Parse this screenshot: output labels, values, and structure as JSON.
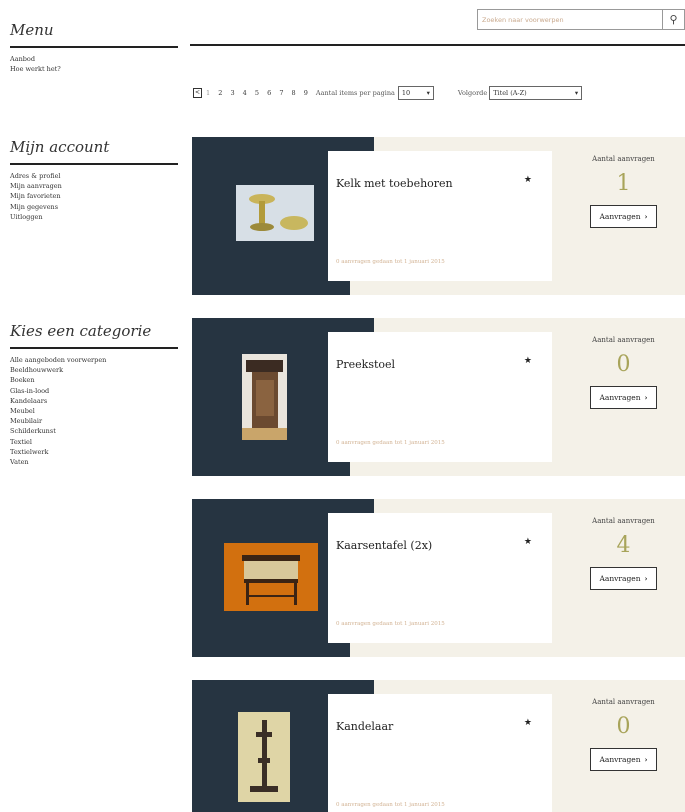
{
  "sidebar": {
    "menu": {
      "heading": "Menu",
      "items": [
        "Aanbod",
        "Hoe werkt het?"
      ]
    },
    "account": {
      "heading": "Mijn account",
      "items": [
        "Adres & profiel",
        "Mijn aanvragen",
        "Mijn favorieten",
        "Mijn gegevens",
        "Uitloggen"
      ]
    },
    "categories": {
      "heading": "Kies een categorie",
      "items": [
        "Alle aangeboden voorwerpen",
        "Beeldhouwwerk",
        "Boeken",
        "Glas-in-lood",
        "Kandelaars",
        "Meubel",
        "Meubilair",
        "Schilderkunst",
        "Textiel",
        "Textielwerk",
        "Vaten"
      ]
    }
  },
  "search": {
    "placeholder": "Zoeken naar voorwerpen",
    "icon": "search-icon"
  },
  "pager": {
    "first_label": "<",
    "pages": [
      "1",
      "2",
      "3",
      "4",
      "5",
      "6",
      "7",
      "8",
      "9"
    ],
    "per_page_label": "Aantal items per pagina",
    "per_page_value": "10",
    "sort_label": "Volgorde",
    "sort_value": "Titel (A-Z)"
  },
  "items": [
    {
      "title": "Kelk met toebehoren",
      "subtitle": "0 aanvragen gedaan tot 1 januari 2015",
      "req_label": "Aantal aanvragen",
      "count": "1",
      "button": "Aanvragen"
    },
    {
      "title": "Preekstoel",
      "subtitle": "0 aanvragen gedaan tot 1 januari 2015",
      "req_label": "Aantal aanvragen",
      "count": "0",
      "button": "Aanvragen"
    },
    {
      "title": "Kaarsentafel (2x)",
      "subtitle": "0 aanvragen gedaan tot 1 januari 2015",
      "req_label": "Aantal aanvragen",
      "count": "4",
      "button": "Aanvragen"
    },
    {
      "title": "Kandelaar",
      "subtitle": "0 aanvragen gedaan tot 1 januari 2015",
      "req_label": "Aantal aanvragen",
      "count": "0",
      "button": "Aanvragen"
    }
  ],
  "colors": {
    "dark": "#263441",
    "panel": "#f4f1e8",
    "count": "#a8a45a"
  }
}
